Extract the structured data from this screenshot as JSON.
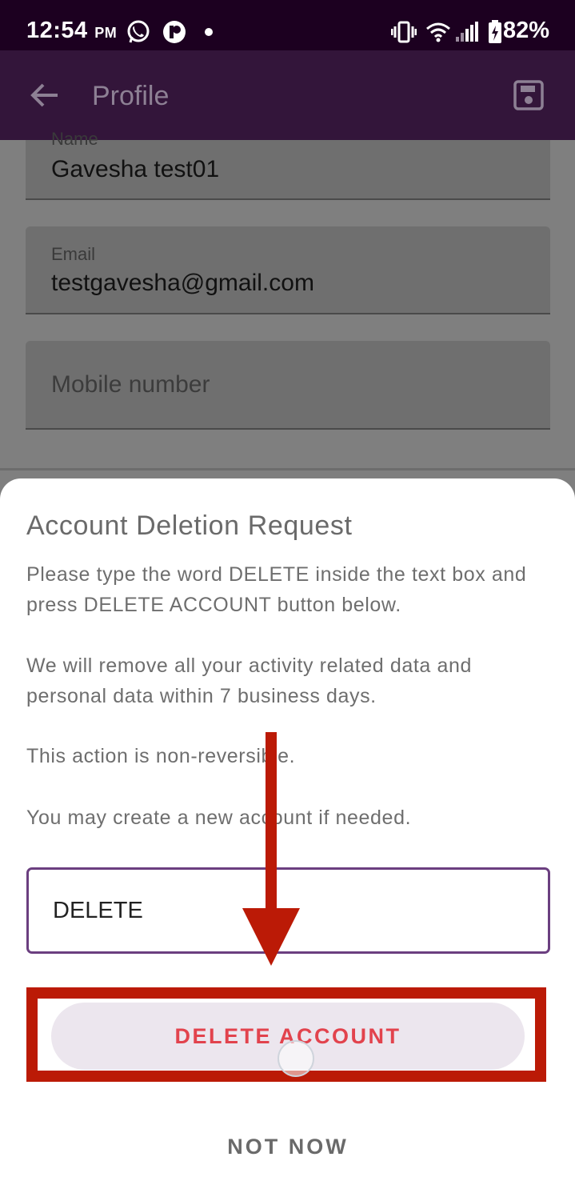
{
  "status_bar": {
    "time": "12:54",
    "ampm": "PM",
    "battery": "82%",
    "icons": [
      "whatsapp-icon",
      "app-notification-icon",
      "dot-icon",
      "vibrate-icon",
      "wifi-icon",
      "signal-icon",
      "battery-charging-icon"
    ]
  },
  "app_bar": {
    "title": "Profile",
    "icons": [
      "back-arrow-icon",
      "save-icon"
    ]
  },
  "profile_form": {
    "name_label": "Name",
    "name_value": "Gavesha test01",
    "email_label": "Email",
    "email_value": "testgavesha@gmail.com",
    "mobile_placeholder": "Mobile number"
  },
  "dialog": {
    "title": "Account Deletion Request",
    "instruction": "Please type the word DELETE inside the text box and press DELETE ACCOUNT button below.",
    "removal_notice": "We will remove all your activity related data and personal data within 7 business days.",
    "irreversible_notice": "This action is non-reversible.",
    "new_account_notice": "You may create a new account if needed.",
    "input_value": "DELETE",
    "delete_button": "DELETE ACCOUNT",
    "not_now_button": "NOT NOW"
  },
  "colors": {
    "status_bar": "#1c0020",
    "app_bar": "#33153a",
    "input_border": "#6b3f80",
    "delete_text": "#e2434d",
    "annotation_red": "#bb1a06"
  }
}
